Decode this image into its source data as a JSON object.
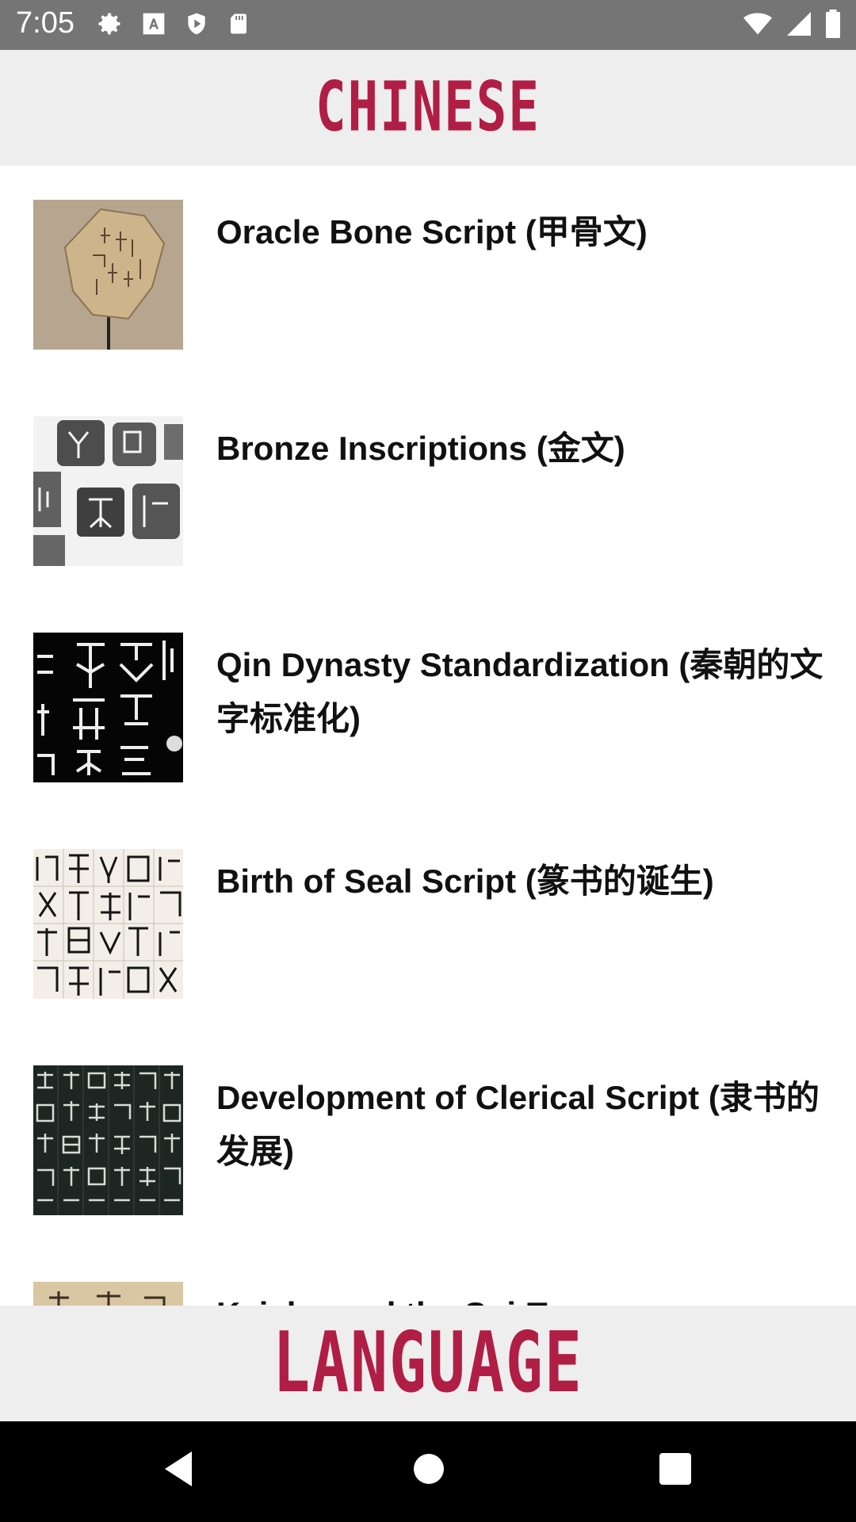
{
  "status_bar": {
    "time": "7:05",
    "left_icons": [
      "gear-icon",
      "font-a-icon",
      "shield-icon",
      "sd-card-icon"
    ],
    "right_icons": [
      "wifi-icon",
      "signal-icon",
      "battery-icon"
    ]
  },
  "header": {
    "title": "CHINESE",
    "color": "#b01e45"
  },
  "items": [
    {
      "title": "Oracle Bone Script (甲骨文)",
      "thumbnail": "oracle-bone-photo"
    },
    {
      "title": "Bronze Inscriptions (金文)",
      "thumbnail": "bronze-inscription-rubbings"
    },
    {
      "title": "Qin Dynasty Standardization (秦朝的文字标准化)",
      "thumbnail": "qin-stone-rubbing"
    },
    {
      "title": "Birth of Seal Script (篆书的诞生)",
      "thumbnail": "seal-script-calligraphy"
    },
    {
      "title": "Development of Clerical Script (隶书的发展)",
      "thumbnail": "clerical-script-rubbing"
    },
    {
      "title": "Kaishu and the Sui-Tang",
      "thumbnail": "kaishu-manuscript"
    }
  ],
  "footer": {
    "title": "LANGUAGE",
    "color": "#b01e45"
  },
  "nav_bar": {
    "buttons": [
      "back-icon",
      "home-icon",
      "recents-icon"
    ]
  }
}
